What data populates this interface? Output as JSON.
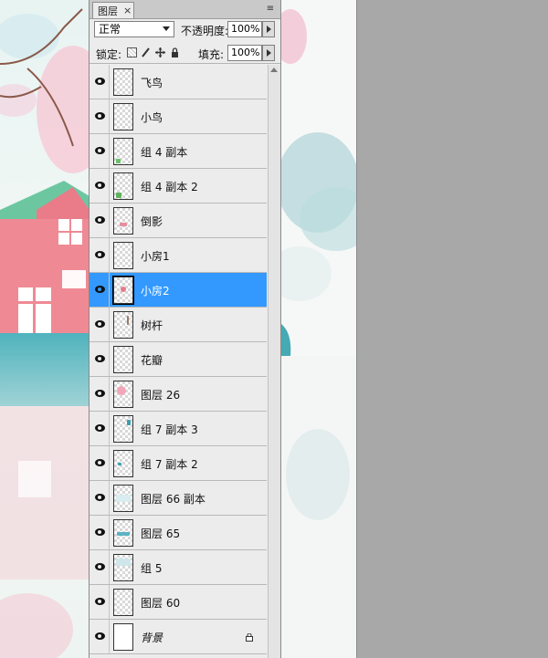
{
  "panel": {
    "tab_label": "图层",
    "tab_close": "×",
    "menu_icon": "≡"
  },
  "controls": {
    "blend_mode": "正常",
    "opacity_label": "不透明度:",
    "opacity_value": "100%",
    "lock_label": "锁定:",
    "fill_label": "填充:",
    "fill_value": "100%"
  },
  "layers": [
    {
      "name": "飞鸟",
      "visible": true,
      "selected": false
    },
    {
      "name": "小鸟",
      "visible": true,
      "selected": false
    },
    {
      "name": "组 4 副本",
      "visible": true,
      "selected": false
    },
    {
      "name": "组 4 副本 2",
      "visible": true,
      "selected": false
    },
    {
      "name": "倒影",
      "visible": true,
      "selected": false
    },
    {
      "name": "小房1",
      "visible": true,
      "selected": false
    },
    {
      "name": "小房2",
      "visible": true,
      "selected": true
    },
    {
      "name": "树杆",
      "visible": true,
      "selected": false
    },
    {
      "name": "花瓣",
      "visible": true,
      "selected": false
    },
    {
      "name": "图层 26",
      "visible": true,
      "selected": false
    },
    {
      "name": "组 7 副本 3",
      "visible": true,
      "selected": false
    },
    {
      "name": "组 7 副本 2",
      "visible": true,
      "selected": false
    },
    {
      "name": "图层 66 副本",
      "visible": true,
      "selected": false
    },
    {
      "name": "图层 65",
      "visible": true,
      "selected": false
    },
    {
      "name": "组 5",
      "visible": true,
      "selected": false
    },
    {
      "name": "图层 60",
      "visible": true,
      "selected": false
    },
    {
      "name": "背景",
      "visible": true,
      "selected": false,
      "locked": true
    }
  ],
  "colors": {
    "selection": "#3399ff",
    "panel_bg": "#ececec",
    "workspace_gray": "#a8a8a8"
  }
}
